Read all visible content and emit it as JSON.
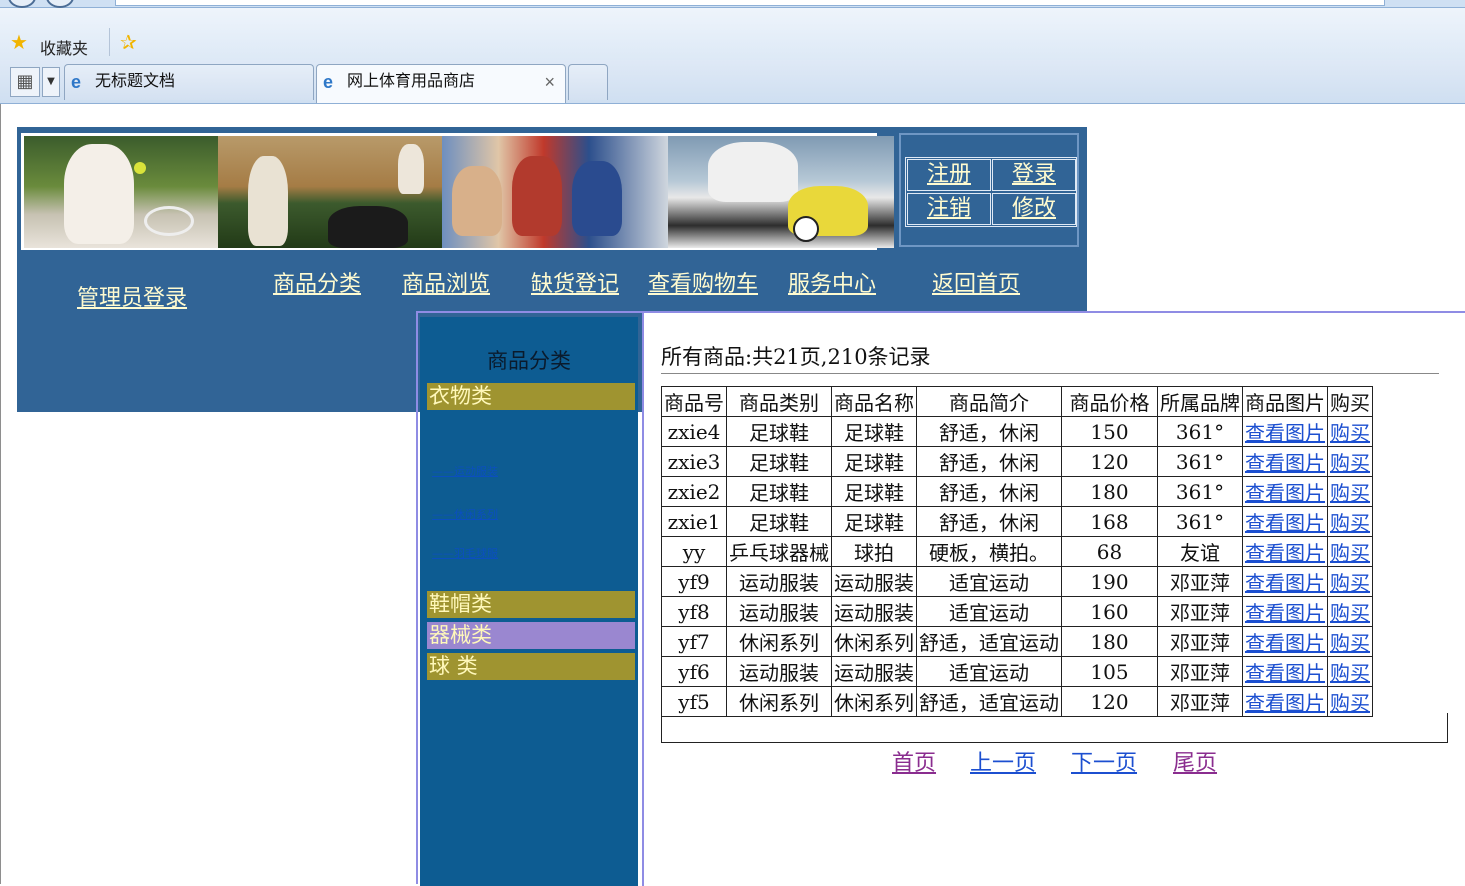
{
  "browser": {
    "favorites_label": "收藏夹",
    "tabs": [
      {
        "label": "无标题文档"
      },
      {
        "label": "网上体育用品商店",
        "close": "×"
      }
    ]
  },
  "header": {
    "auth": {
      "register": "注册",
      "login": "登录",
      "logout": "注销",
      "modify": "修改"
    },
    "nav": [
      "管理员登录",
      "商品分类",
      "商品浏览",
      "缺货登记",
      "查看购物车",
      "服务中心",
      "返回首页"
    ]
  },
  "sidebar": {
    "title": "商品分类",
    "categories": [
      "衣物类",
      "鞋帽类",
      "器械类",
      "球  类"
    ],
    "sub_links": [
      "——运动服装",
      "——休闲系列",
      "——羽毛球服"
    ]
  },
  "main": {
    "records_text": "所有商品:共21页,210条记录",
    "table": {
      "headers": [
        "商品号",
        "商品类别",
        "商品名称",
        "商品简介",
        "商品价格",
        "所属品牌",
        "商品图片",
        "购买"
      ],
      "rows": [
        [
          "zxie4",
          "足球鞋",
          "足球鞋",
          "舒适，休闲",
          "150",
          "361°",
          "查看图片",
          "购买"
        ],
        [
          "zxie3",
          "足球鞋",
          "足球鞋",
          "舒适，休闲",
          "120",
          "361°",
          "查看图片",
          "购买"
        ],
        [
          "zxie2",
          "足球鞋",
          "足球鞋",
          "舒适，休闲",
          "180",
          "361°",
          "查看图片",
          "购买"
        ],
        [
          "zxie1",
          "足球鞋",
          "足球鞋",
          "舒适，休闲",
          "168",
          "361°",
          "查看图片",
          "购买"
        ],
        [
          "yy",
          "乒乓球器械",
          "球拍",
          "硬板，横拍。",
          "68",
          "友谊",
          "查看图片",
          "购买"
        ],
        [
          "yf9",
          "运动服装",
          "运动服装",
          "适宜运动",
          "190",
          "邓亚萍",
          "查看图片",
          "购买"
        ],
        [
          "yf8",
          "运动服装",
          "运动服装",
          "适宜运动",
          "160",
          "邓亚萍",
          "查看图片",
          "购买"
        ],
        [
          "yf7",
          "休闲系列",
          "休闲系列",
          "舒适，适宜运动",
          "180",
          "邓亚萍",
          "查看图片",
          "购买"
        ],
        [
          "yf6",
          "运动服装",
          "运动服装",
          "适宜运动",
          "105",
          "邓亚萍",
          "查看图片",
          "购买"
        ],
        [
          "yf5",
          "休闲系列",
          "休闲系列",
          "舒适，适宜运动",
          "120",
          "邓亚萍",
          "查看图片",
          "购买"
        ]
      ]
    },
    "pager": {
      "first": "首页",
      "prev": "上一页",
      "next": "下一页",
      "last": "尾页"
    }
  },
  "colors": {
    "header_blue": "#316496",
    "sidebar_blue": "#0d5c92",
    "category_olive": "#9f9430",
    "category_active": "#9a87d0",
    "link_visited": "#8a2d8f",
    "link_blue": "#1c4fd0"
  }
}
